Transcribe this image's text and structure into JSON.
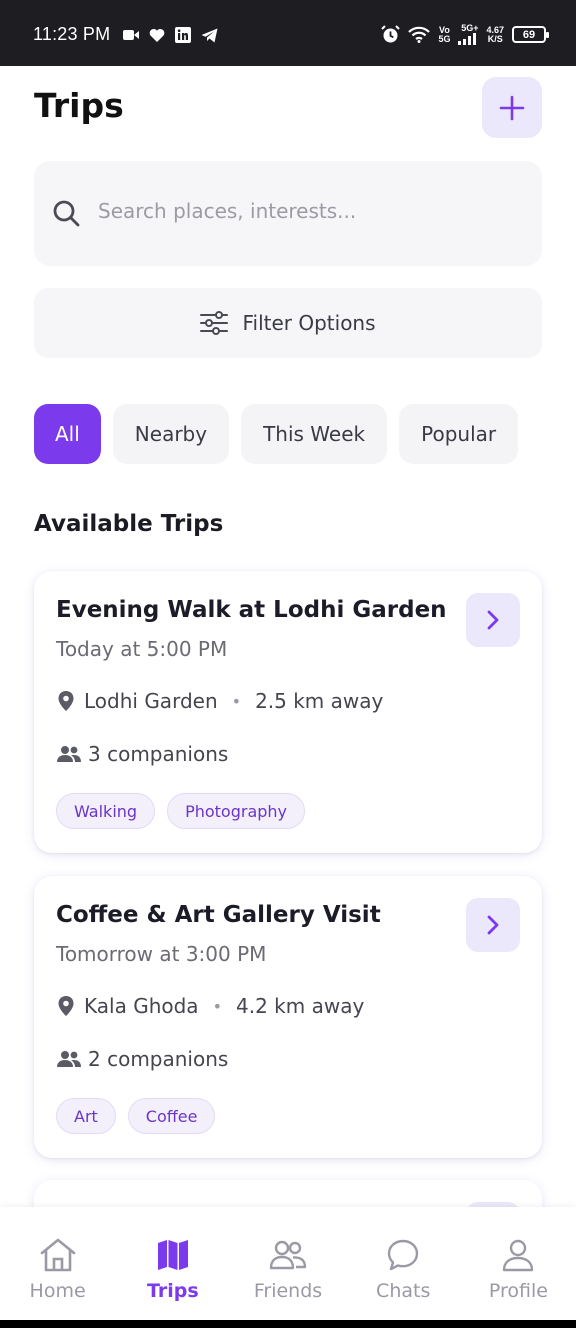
{
  "status_bar": {
    "time": "11:23 PM",
    "left_icons": [
      "video-icon",
      "heart-icon",
      "linkedin-icon",
      "telegram-icon"
    ],
    "right_icons": [
      "alarm-icon",
      "wifi-icon",
      "volte-icon",
      "signal-icon",
      "net-speed",
      "battery-icon"
    ],
    "volte_top": "Vo",
    "volte_bottom": "5G",
    "net_type": "5G+",
    "net_speed_top": "4.67",
    "net_speed_bottom": "K/S",
    "battery": "69"
  },
  "header": {
    "title": "Trips",
    "add_icon": "plus-icon"
  },
  "search": {
    "placeholder": "Search places, interests...",
    "icon": "search-icon"
  },
  "filter": {
    "label": "Filter Options",
    "icon": "sliders-icon"
  },
  "chips": [
    {
      "label": "All",
      "active": true
    },
    {
      "label": "Nearby",
      "active": false
    },
    {
      "label": "This Week",
      "active": false
    },
    {
      "label": "Popular",
      "active": false
    }
  ],
  "section_title": "Available Trips",
  "trips": [
    {
      "title": "Evening Walk at Lodhi Garden",
      "time": "Today at 5:00 PM",
      "location": "Lodhi Garden",
      "distance": "2.5 km away",
      "companions": "3 companions",
      "tags": [
        "Walking",
        "Photography"
      ]
    },
    {
      "title": "Coffee & Art Gallery Visit",
      "time": "Tomorrow at 3:00 PM",
      "location": "Kala Ghoda",
      "distance": "4.2 km away",
      "companions": "2 companions",
      "tags": [
        "Art",
        "Coffee"
      ]
    }
  ],
  "bottom_nav": [
    {
      "label": "Home",
      "icon": "home-icon",
      "active": false
    },
    {
      "label": "Trips",
      "icon": "map-icon",
      "active": true
    },
    {
      "label": "Friends",
      "icon": "friends-icon",
      "active": false
    },
    {
      "label": "Chats",
      "icon": "chat-icon",
      "active": false
    },
    {
      "label": "Profile",
      "icon": "profile-icon",
      "active": false
    }
  ],
  "colors": {
    "accent": "#7c3aed",
    "accent_light": "#ece8fb",
    "surface": "#f6f6f9",
    "status_bar": "#1d1d22"
  }
}
